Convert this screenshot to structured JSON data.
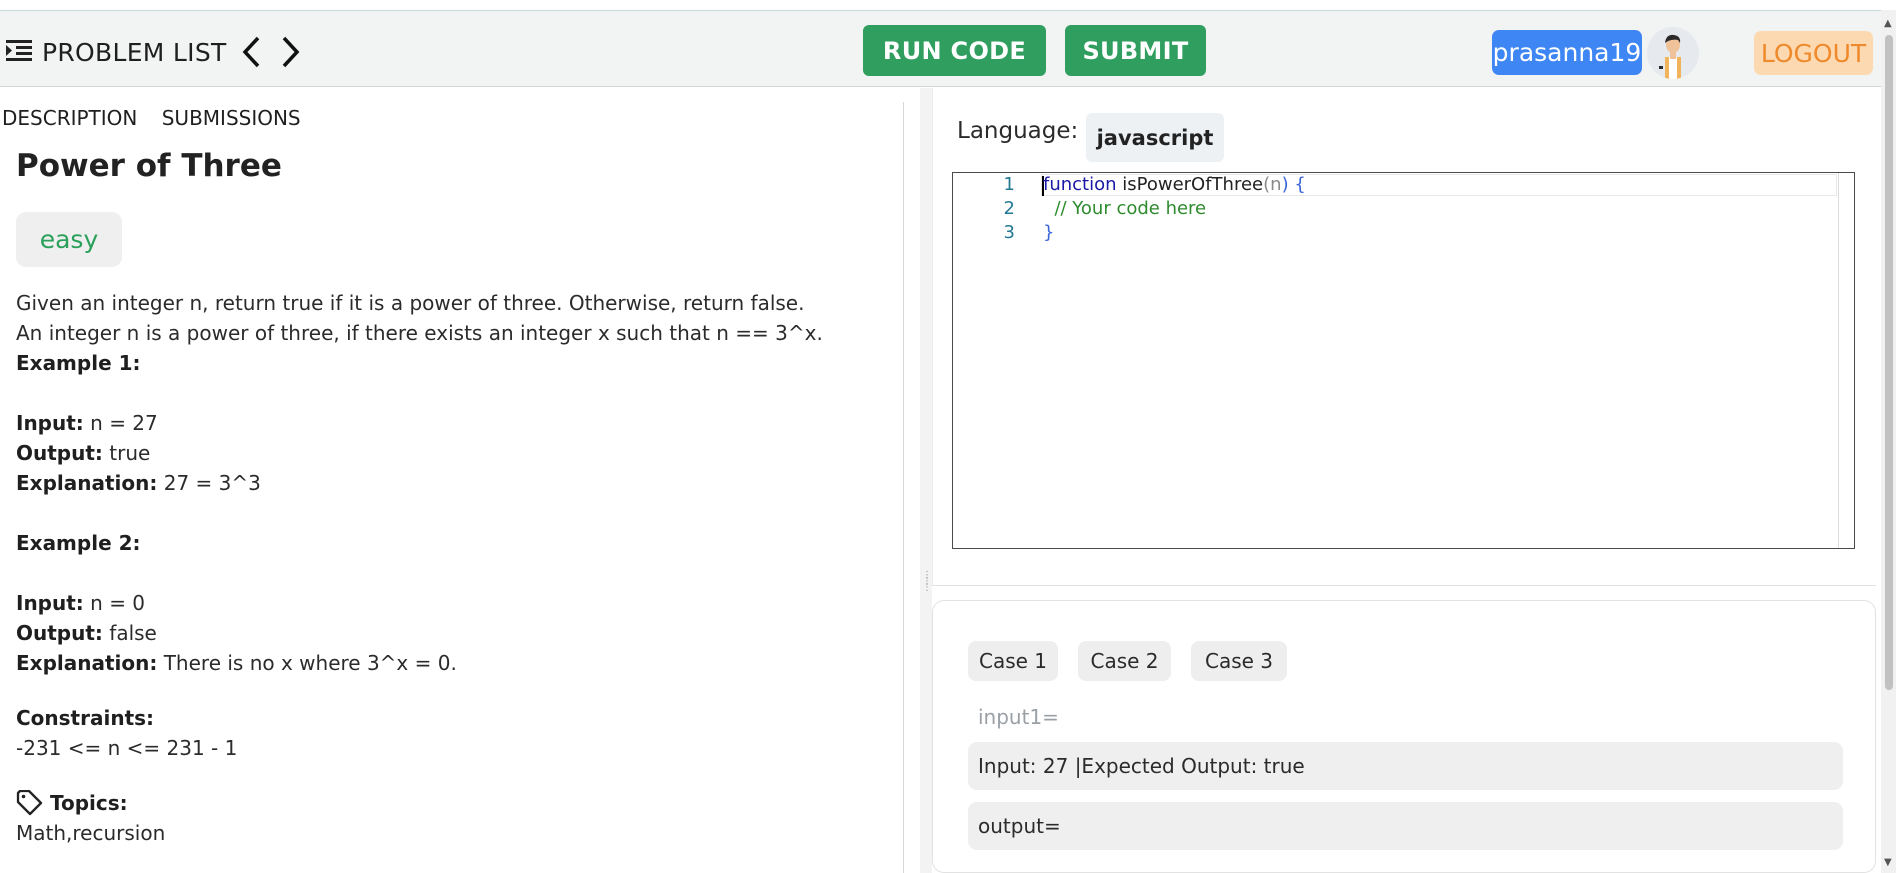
{
  "header": {
    "problem_list_label": "PROBLEM LIST",
    "run_code_label": "RUN CODE",
    "submit_label": "SUBMIT",
    "username": "prasanna19",
    "logout_label": "LOGOUT"
  },
  "left_tabs": [
    "DESCRIPTION",
    "SUBMISSIONS"
  ],
  "problem": {
    "title": "Power of Three",
    "difficulty": "easy",
    "statement": "Given an integer n, return true if it is a power of three. Otherwise, return false. An integer n is a power of three, if there exists an integer x such that n == 3^x.",
    "example1_heading": "Example 1:",
    "example1_input_label": "Input:",
    "example1_input": "n = 27",
    "example1_output_label": "Output:",
    "example1_output": "true",
    "example1_expl_label": "Explanation:",
    "example1_expl": "27 = 3^3",
    "example2_heading": "Example 2:",
    "example2_input_label": "Input:",
    "example2_input": "n = 0",
    "example2_output_label": "Output:",
    "example2_output": "false",
    "example2_expl_label": "Explanation:",
    "example2_expl": "There is no x where 3^x = 0.",
    "constraints_heading": "Constraints:",
    "constraints": "-231 <= n <= 231 - 1",
    "topics_heading": "Topics:",
    "topics": "Math,recursion"
  },
  "editor": {
    "language_label": "Language:",
    "language": "javascript",
    "line_numbers": [
      "1",
      "2",
      "3"
    ],
    "line1_kw": "function",
    "line1_name": " isPowerOfThree",
    "line1_open": "(",
    "line1_param": "n",
    "line1_close": ") {",
    "line2": "  // Your code here",
    "line3": "}"
  },
  "testcases": {
    "tabs": [
      "Case 1",
      "Case 2",
      "Case 3"
    ],
    "input_label": "input1=",
    "input_value": "Input: 27 |Expected Output: true",
    "output_label": "output="
  },
  "colors": {
    "accent_green": "#2f9e5e",
    "user_blue": "#3d86f4",
    "logout_bg": "#fdd9b2",
    "logout_text": "#ef8a2c",
    "easy_green": "#2ba05a"
  },
  "icons": [
    "indent-list-icon",
    "chevron-left-icon",
    "chevron-right-icon",
    "user-avatar",
    "tag-icon"
  ]
}
